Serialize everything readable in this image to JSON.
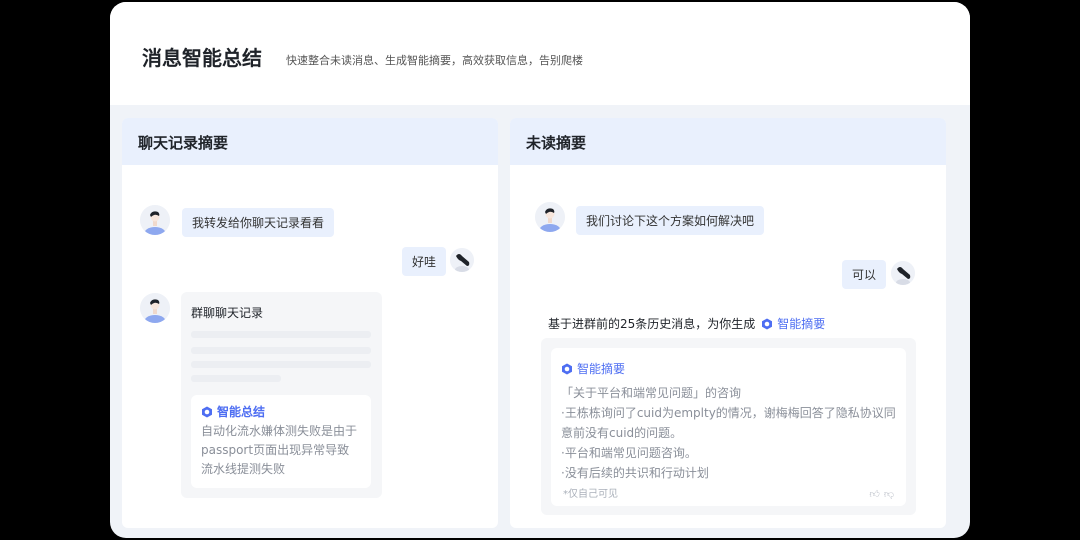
{
  "header": {
    "title": "消息智能总结",
    "subtitle": "快速整合未读消息、生成智能摘要，高效获取信息，告别爬楼"
  },
  "left": {
    "title": "聊天记录摘要",
    "msg1": "我转发给你聊天记录看看",
    "reply": "好哇",
    "group_title": "群聊聊天记录",
    "ai_label": "智能总结",
    "ai_text": "自动化流水嫌体测失败是由于passport页面出现异常导致流水线提测失败"
  },
  "right": {
    "title": "未读摘要",
    "msg1": "我们讨论下这个方案如何解决吧",
    "reply": "可以",
    "intro": "基于进群前的25条历史消息，为你生成",
    "intro_ai": "智能摘要",
    "ai_label": "智能摘要",
    "lines": [
      "「关于平台和端常见问题」的咨询",
      "·王栋栋询问了cuid为emplty的情况，谢梅梅回答了隐私协议同意前没有cuid的问题。",
      "·平台和端常见问题咨询。",
      "·没有后续的共识和行动计划"
    ],
    "note": "*仅自己可见"
  },
  "colors": {
    "accent": "#4e6ef2",
    "panel_header": "#e9f0fd"
  }
}
